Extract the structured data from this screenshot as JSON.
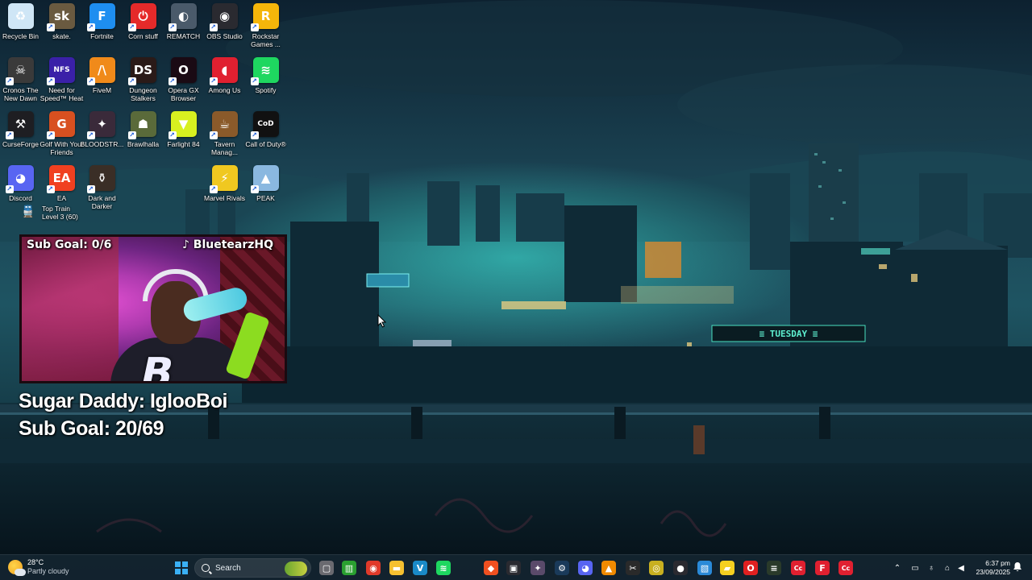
{
  "desktop": {
    "icons": [
      {
        "label": "Recycle Bin",
        "icon": "recycle-bin-icon",
        "color": "#cfe6f6"
      },
      {
        "label": "skate.",
        "icon": "skate-icon",
        "color": "#6a5a40"
      },
      {
        "label": "Fortnite",
        "icon": "fortnite-icon",
        "color": "#1e8ef0"
      },
      {
        "label": "Corn stuff",
        "icon": "power-icon",
        "color": "#e52a2a"
      },
      {
        "label": "REMATCH",
        "icon": "rematch-icon",
        "color": "#4a5a6a"
      },
      {
        "label": "OBS Studio",
        "icon": "obs-icon",
        "color": "#2a2a30"
      },
      {
        "label": "Rockstar Games ...",
        "icon": "rockstar-icon",
        "color": "#f5b60a"
      },
      {
        "label": "Cronos The New Dawn",
        "icon": "cronos-icon",
        "color": "#3a3a3a"
      },
      {
        "label": "Need for Speed™ Heat",
        "icon": "nfs-icon",
        "color": "#3a20a8"
      },
      {
        "label": "FiveM",
        "icon": "fivem-icon",
        "color": "#f08a1a"
      },
      {
        "label": "Dungeon Stalkers",
        "icon": "dungeon-stalkers-icon",
        "color": "#2a1a18"
      },
      {
        "label": "Opera GX Browser",
        "icon": "opera-gx-icon",
        "color": "#1a0a14"
      },
      {
        "label": "Among Us",
        "icon": "among-us-icon",
        "color": "#e02030"
      },
      {
        "label": "Spotify",
        "icon": "spotify-icon",
        "color": "#1ed760"
      },
      {
        "label": "CurseForge",
        "icon": "curseforge-icon",
        "color": "#1e1e22"
      },
      {
        "label": "Golf With Your Friends",
        "icon": "golf-icon",
        "color": "#d85020"
      },
      {
        "label": "BLOODSTR...",
        "icon": "bloodstrike-icon",
        "color": "#3a2a3a"
      },
      {
        "label": "Brawlhalla",
        "icon": "brawlhalla-icon",
        "color": "#5a6a3a"
      },
      {
        "label": "Farlight 84",
        "icon": "farlight-icon",
        "color": "#d8f020"
      },
      {
        "label": "Tavern Manag...",
        "icon": "tavern-icon",
        "color": "#8a5a2a"
      },
      {
        "label": "Call of Duty®",
        "icon": "call-of-duty-icon",
        "color": "#111"
      },
      {
        "label": "Discord",
        "icon": "discord-icon",
        "color": "#5865f2"
      },
      {
        "label": "EA",
        "icon": "ea-icon",
        "color": "#f04020"
      },
      {
        "label": "Dark and Darker",
        "icon": "dark-and-darker-icon",
        "color": "#3a2e26"
      },
      {
        "label": "Marvel Rivals",
        "icon": "marvel-rivals-icon",
        "color": "#f0c820"
      },
      {
        "label": "PEAK",
        "icon": "peak-icon",
        "color": "#8ab8e0"
      },
      {
        "label": "Top Train Level 3 (60)",
        "icon": "train-icon",
        "color": "#ffffff"
      }
    ]
  },
  "stream": {
    "cam_goal": "Sub Goal: 0/6",
    "cam_handle": "♪ BluetearzHQ",
    "sugar_daddy": "Sugar Daddy: IglooBoi",
    "sub_goal": "Sub Goal: 20/69",
    "logo_mark": "B"
  },
  "taskbar": {
    "weather_temp": "28°C",
    "weather_cond": "Partly cloudy",
    "search_placeholder": "Search",
    "apps": [
      {
        "icon": "file-explorer-dark-icon",
        "color": "#6a6a70",
        "glyph": "▢"
      },
      {
        "icon": "xbox-game-bar-icon",
        "color": "#2aa030",
        "glyph": "▥"
      },
      {
        "icon": "chrome-icon",
        "color": "#e03a2a",
        "glyph": "◉"
      },
      {
        "icon": "file-explorer-icon",
        "color": "#f5c030",
        "glyph": "▬"
      },
      {
        "icon": "vegas-icon",
        "color": "#1a8ac8",
        "glyph": "V"
      },
      {
        "icon": "spotify-taskbar-icon",
        "color": "#1ed760",
        "glyph": "≋"
      },
      {
        "icon": "brave-icon",
        "color": "#f05020",
        "glyph": "◆"
      },
      {
        "icon": "capcut-icon",
        "color": "#2a2a30",
        "glyph": "▣"
      },
      {
        "icon": "davinci-icon",
        "color": "#5a4a6a",
        "glyph": "✦"
      },
      {
        "icon": "steam-icon",
        "color": "#1a3a5a",
        "glyph": "⚙"
      },
      {
        "icon": "discord-taskbar-icon",
        "color": "#5865f2",
        "glyph": "◕"
      },
      {
        "icon": "vlc-icon",
        "color": "#f08a00",
        "glyph": "▲"
      },
      {
        "icon": "capcut-alt-icon",
        "color": "#2a2a2a",
        "glyph": "✂"
      },
      {
        "icon": "chrome-canary-icon",
        "color": "#c8b020",
        "glyph": "◎"
      },
      {
        "icon": "obs-taskbar-icon",
        "color": "#2a2a30",
        "glyph": "●"
      },
      {
        "icon": "photos-icon",
        "color": "#2a8ad8",
        "glyph": "▧"
      },
      {
        "icon": "sticky-notes-icon",
        "color": "#f5d020",
        "glyph": "▰"
      },
      {
        "icon": "opera-taskbar-icon",
        "color": "#e02020",
        "glyph": "O"
      },
      {
        "icon": "terminal-icon",
        "color": "#2a3a2a",
        "glyph": "≡"
      },
      {
        "icon": "creative-cloud-icon",
        "color": "#e02030",
        "glyph": "Cc"
      },
      {
        "icon": "tiktok-icon",
        "color": "#e02030",
        "glyph": "F"
      },
      {
        "icon": "creative-cloud-alt-icon",
        "color": "#e02030",
        "glyph": "Cc"
      }
    ],
    "time": "6:37 pm",
    "date": "23/09/2025"
  }
}
